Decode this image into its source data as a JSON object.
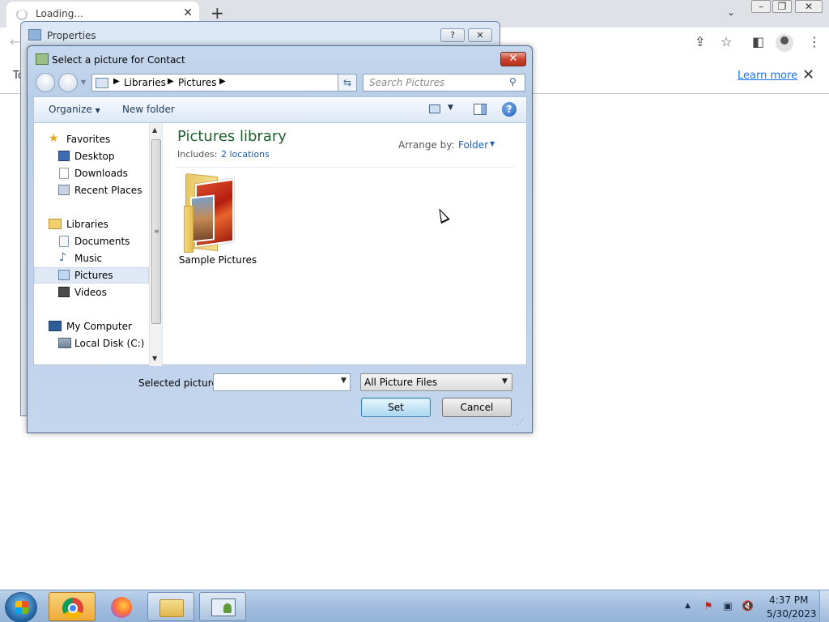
{
  "browser": {
    "tab_title": "Loading...",
    "tab_close": "✕",
    "new_tab": "+",
    "infobar_text": "To",
    "learn_more": "Learn more",
    "infobar_close": "✕"
  },
  "properties_window": {
    "title": "Properties",
    "help_btn": "?",
    "close_btn": "✕"
  },
  "dialog": {
    "title": "Select a picture for Contact",
    "close_btn": "✕",
    "breadcrumbs": [
      "Libraries",
      "Pictures"
    ],
    "search_placeholder": "Search Pictures",
    "toolbar": {
      "organize": "Organize",
      "new_folder": "New folder",
      "help": "?"
    },
    "nav": {
      "favorites": "Favorites",
      "desktop": "Desktop",
      "downloads": "Downloads",
      "recent_places": "Recent Places",
      "libraries": "Libraries",
      "documents": "Documents",
      "music": "Music",
      "pictures": "Pictures",
      "videos": "Videos",
      "my_computer": "My Computer",
      "local_disk": "Local Disk (C:)"
    },
    "library": {
      "title": "Pictures library",
      "includes_label": "Includes:",
      "locations": "2 locations",
      "arrange_label": "Arrange by:",
      "arrange_value": "Folder"
    },
    "items": [
      {
        "label": "Sample Pictures"
      }
    ],
    "footer": {
      "selected_label": "Selected picture:",
      "selected_value": "",
      "filter_value": "All Picture Files",
      "set_button": "Set",
      "cancel_button": "Cancel"
    }
  },
  "taskbar": {
    "time": "4:37 PM",
    "date": "5/30/2023"
  }
}
